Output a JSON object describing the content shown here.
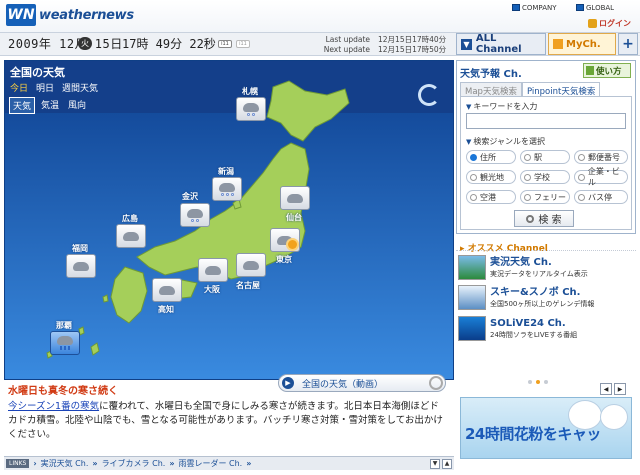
{
  "header": {
    "logo_mark": "WN",
    "logo_text": "weathernews",
    "company_link": "COMPANY",
    "global_link": "GLOBAL",
    "login": "ログイン"
  },
  "datebar": {
    "date": "2009年 12月 15日",
    "day": "火",
    "time": "17時 49分 22秒",
    "btn1": "i11",
    "btn2": "i11",
    "last_update_label": "Last update",
    "last_update_value": "12月15日17時40分",
    "next_update_label": "Next update",
    "next_update_value": "12月15日17時50分",
    "all_channel": "ALL Channel",
    "my_channel": "MyCh.",
    "plus": "+"
  },
  "map": {
    "title": "全国の天気",
    "day_tabs": [
      "今日",
      "明日",
      "週間天気"
    ],
    "type_tabs": [
      "天気",
      "気温",
      "風向"
    ],
    "cities": {
      "sapporo": "札幌",
      "niigata": "新潟",
      "kanazawa": "金沢",
      "sendai": "仙台",
      "hiroshima": "広島",
      "tokyo": "東京",
      "fukuoka": "福岡",
      "osaka": "大阪",
      "nagoya": "名古屋",
      "kochi": "高知",
      "naha": "那覇"
    },
    "weather": {
      "sapporo": "snow",
      "niigata": "snow",
      "kanazawa": "snow",
      "sendai": "cloudy",
      "hiroshima": "cloudy",
      "tokyo": "sunny-cloudy",
      "fukuoka": "cloudy",
      "osaka": "cloudy",
      "nagoya": "cloudy",
      "kochi": "cloudy",
      "naha": "rain"
    }
  },
  "news": {
    "headline": "水曜日も真冬の寒さ続く",
    "link_text": "今シーズン1番の寒気",
    "body": "に覆われて、水曜日も全国で身にしみる寒さが続きます。北日本日本海側ほどドカドカ積雪。北陸や山陰でも、雪となる可能性があります。バッチリ寒さ対策・雪対策をしてお出かけください。",
    "video_button": "全国の天気（動画）"
  },
  "links_bar": {
    "label": "LINKS",
    "items": [
      "実況天気 Ch.",
      "ライブカメラ Ch.",
      "雨雲レーダー Ch."
    ]
  },
  "forecast_panel": {
    "title": "天気予報 Ch.",
    "howto": "使い方",
    "tabs": [
      "Map天気検索",
      "Pinpoint天気検索"
    ],
    "keyword_label": "キーワードを入力",
    "keyword_placeholder": "",
    "genre_label": "検索ジャンルを選択",
    "genres": [
      "住所",
      "駅",
      "郵便番号",
      "観光地",
      "学校",
      "企業・ビル",
      "空港",
      "フェリー",
      "バス停"
    ],
    "selected_genre": "住所",
    "search_button": "検 索"
  },
  "recommended": {
    "title": "オススメ Channel",
    "items": [
      {
        "title": "実況天気 Ch.",
        "desc": "実況データをリアルタイム表示"
      },
      {
        "title": "スキー&スノボ Ch.",
        "desc": "全国500ヶ所以上のゲレンデ情報"
      },
      {
        "title": "SOLiVE24 Ch.",
        "desc": "24時間ソラをLIVEする番組"
      }
    ]
  },
  "banner": {
    "text": "24時間花粉をキャッ"
  },
  "colors": {
    "brand": "#1560b8",
    "map_sea": "#1e6bc6",
    "land": "#a5cf5a",
    "accent_orange": "#f0a020",
    "news_red": "#d13b14"
  }
}
